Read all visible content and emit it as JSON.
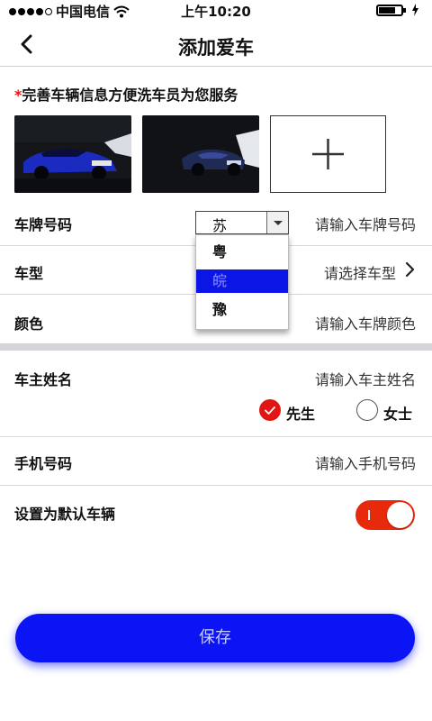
{
  "statusbar": {
    "carrier": "中国电信",
    "time": "上午10:20"
  },
  "nav": {
    "title": "添加爱车"
  },
  "form": {
    "required_mark": "*",
    "hint": "完善车辆信息方便洗车员为您服务",
    "plate": {
      "label": "车牌号码",
      "province_selected": "苏",
      "province_options": [
        "粤",
        "皖",
        "豫"
      ],
      "province_highlighted_index": 1,
      "placeholder": "请输入车牌号码"
    },
    "model": {
      "label": "车型",
      "placeholder": "请选择车型"
    },
    "color": {
      "label": "颜色",
      "placeholder": "请输入车牌颜色"
    },
    "owner": {
      "label": "车主姓名",
      "placeholder": "请输入车主姓名",
      "gender_options": [
        "先生",
        "女士"
      ],
      "gender_selected": "先生"
    },
    "phone": {
      "label": "手机号码",
      "placeholder": "请输入手机号码"
    },
    "default_vehicle": {
      "label": "设置为默认车辆",
      "enabled": true
    }
  },
  "colors": {
    "accent_red": "#e01515",
    "button_blue": "#0b14f5",
    "toggle_red": "#e82a0c"
  },
  "save_button": {
    "label": "保存"
  }
}
